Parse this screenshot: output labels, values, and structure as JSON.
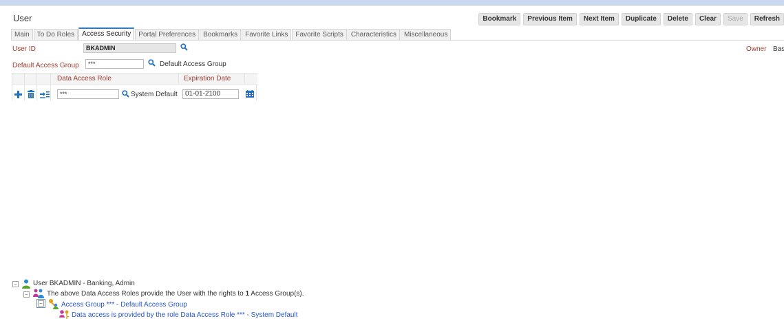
{
  "page": {
    "title": "User"
  },
  "toolbar": [
    {
      "label": "Bookmark",
      "enabled": true
    },
    {
      "label": "Previous Item",
      "enabled": true
    },
    {
      "label": "Next Item",
      "enabled": true
    },
    {
      "label": "Duplicate",
      "enabled": true
    },
    {
      "label": "Delete",
      "enabled": true
    },
    {
      "label": "Clear",
      "enabled": true
    },
    {
      "label": "Save",
      "enabled": false
    },
    {
      "label": "Refresh",
      "enabled": true
    }
  ],
  "tabs": [
    {
      "label": "Main",
      "active": false
    },
    {
      "label": "To Do Roles",
      "active": false
    },
    {
      "label": "Access Security",
      "active": true
    },
    {
      "label": "Portal Preferences",
      "active": false
    },
    {
      "label": "Bookmarks",
      "active": false
    },
    {
      "label": "Favorite Links",
      "active": false
    },
    {
      "label": "Favorite Scripts",
      "active": false
    },
    {
      "label": "Characteristics",
      "active": false
    },
    {
      "label": "Miscellaneous",
      "active": false
    }
  ],
  "form": {
    "user_id_label": "User ID",
    "user_id_value": "BKADMIN",
    "owner_label": "Owner",
    "owner_value": "Bas",
    "default_access_group_label": "Default Access Group",
    "default_access_group_value": "***",
    "default_access_group_desc": "Default Access Group"
  },
  "grid": {
    "columns": [
      "Data Access Role",
      "Expiration Date"
    ],
    "rows": [
      {
        "role": "***",
        "role_desc": "System Default",
        "expiration": "01-01-2100"
      }
    ]
  },
  "tree": {
    "user_line": "User BKADMIN - Banking, Admin",
    "roles_line_pre": "The above Data Access Roles provide the User with the rights to ",
    "roles_line_count": "1",
    "roles_line_post": " Access Group(s).",
    "access_group_line": "Access Group *** - Default Access Group",
    "provided_line": "Data access is provided by the role Data Access Role *** - System Default"
  },
  "colors": {
    "label": "#9a3a2c",
    "tab_active_accent": "#2b7cc6",
    "link": "#2554c7",
    "icon_blue": "#1f6fc4"
  }
}
